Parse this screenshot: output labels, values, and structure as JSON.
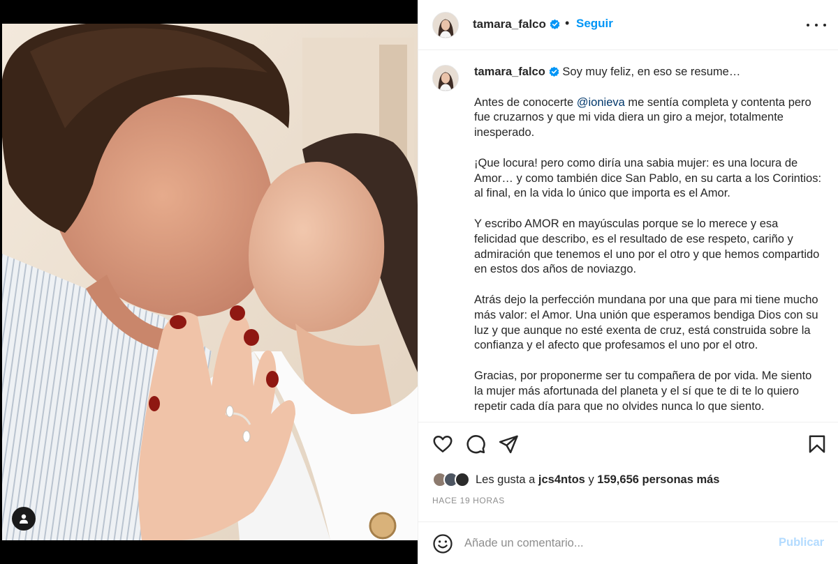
{
  "post": {
    "username": "tamara_falco",
    "follow_label": "Seguir",
    "separator": "•",
    "caption": {
      "username": "tamara_falco",
      "first_line": "Soy muy feliz, en eso se resume…",
      "p1_before": "Antes de conocerte ",
      "p1_mention": "@ionieva",
      "p1_after": " me sentía completa y contenta pero fue cruzarnos y que mi vida diera un giro a mejor, totalmente inesperado.",
      "p2": "¡Que locura! pero como diría una sabia mujer: es una locura de Amor… y como también dice San Pablo, en su carta a los Corintios: al final, en la vida lo único que importa es el Amor.",
      "p3": "Y escribo AMOR en mayúsculas porque se lo merece y esa felicidad que describo, es el resultado de ese respeto, cariño y admiración que tenemos el uno por el otro y que hemos compartido en estos dos años de noviazgo.",
      "p4": "Atrás dejo la perfección mundana por una que para mi tiene mucho más valor: el Amor. Una unión que esperamos bendiga Dios con su luz y que aunque no esté exenta de cruz, está construida sobre la confianza y el afecto que profesamos el uno por el otro.",
      "p5": "Gracias, por proponerme ser tu compañera de por vida. Me siento la mujer más afortunada del planeta y el sí que te di te lo quiero repetir cada día para que no olvides nunca lo que siento."
    },
    "likes": {
      "prefix": "Les gusta a ",
      "first_user": "jcs4ntos",
      "middle": " y ",
      "others": "159,656 personas más"
    },
    "timestamp": "HACE 19 HORAS",
    "comment": {
      "placeholder": "Añade un comentario...",
      "value": "",
      "publish_label": "Publicar"
    }
  },
  "icons": {
    "verified": "verified-badge-icon",
    "more": "more-options-icon",
    "like": "heart-icon",
    "comment": "comment-bubble-icon",
    "share": "paper-plane-icon",
    "save": "bookmark-icon",
    "emoji": "smiley-icon",
    "user_tag": "person-icon"
  },
  "colors": {
    "link_blue": "#0095f6",
    "mention": "#00376b",
    "verified": "#0095f6",
    "muted": "#8e8e8e",
    "publish_disabled": "#b3dbff"
  }
}
